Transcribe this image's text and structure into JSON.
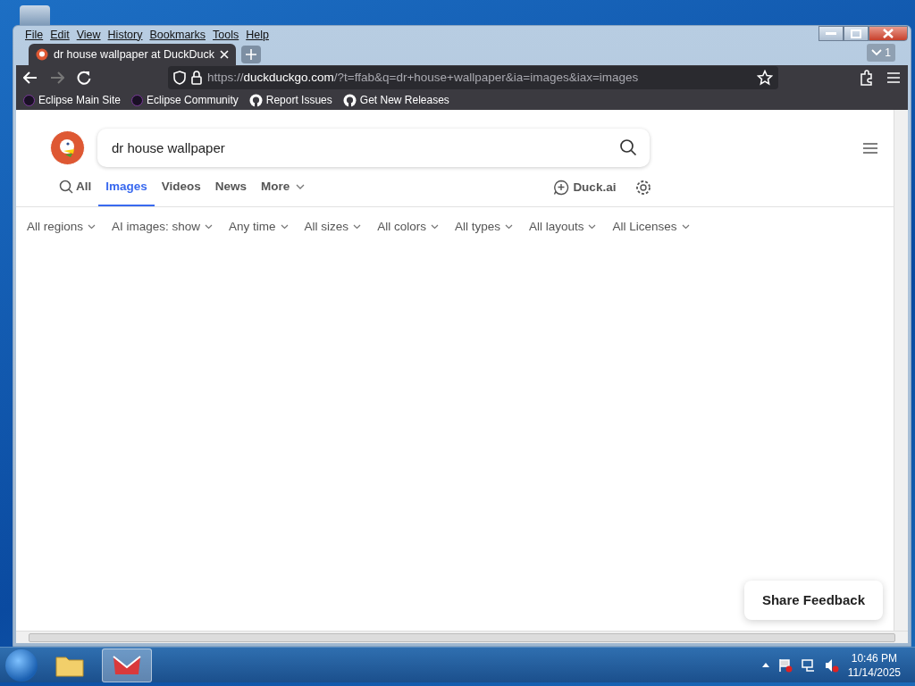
{
  "menu": [
    "File",
    "Edit",
    "View",
    "History",
    "Bookmarks",
    "Tools",
    "Help"
  ],
  "tabs": [
    {
      "label": "dr house wallpaper at DuckDuck",
      "selected": true
    }
  ],
  "tab_list_count": "1",
  "url": {
    "scheme": "https://",
    "host": "duckduckgo.com",
    "rest": "/?t=ffab&q=dr+house+wallpaper&ia=images&iax=images"
  },
  "bookmarks": [
    {
      "label": "Eclipse Main Site",
      "kind": "eclipse"
    },
    {
      "label": "Eclipse Community",
      "kind": "eclipse"
    },
    {
      "label": "Report Issues",
      "kind": "github"
    },
    {
      "label": "Get New Releases",
      "kind": "github"
    }
  ],
  "search": {
    "value": "dr house wallpaper"
  },
  "verticals": [
    {
      "label": "All",
      "selected": false,
      "kind": "search"
    },
    {
      "label": "Images",
      "selected": true,
      "kind": "plain"
    },
    {
      "label": "Videos",
      "selected": false,
      "kind": "plain"
    },
    {
      "label": "News",
      "selected": false,
      "kind": "plain"
    },
    {
      "label": "More",
      "selected": false,
      "kind": "dropdown"
    }
  ],
  "duck_ai": "Duck.ai",
  "filters": [
    "All regions",
    "AI images: show",
    "Any time",
    "All sizes",
    "All colors",
    "All types",
    "All layouts",
    "All Licenses"
  ],
  "feedback": "Share Feedback",
  "clock": {
    "time": "10:46 PM",
    "date": "11/14/2025"
  }
}
